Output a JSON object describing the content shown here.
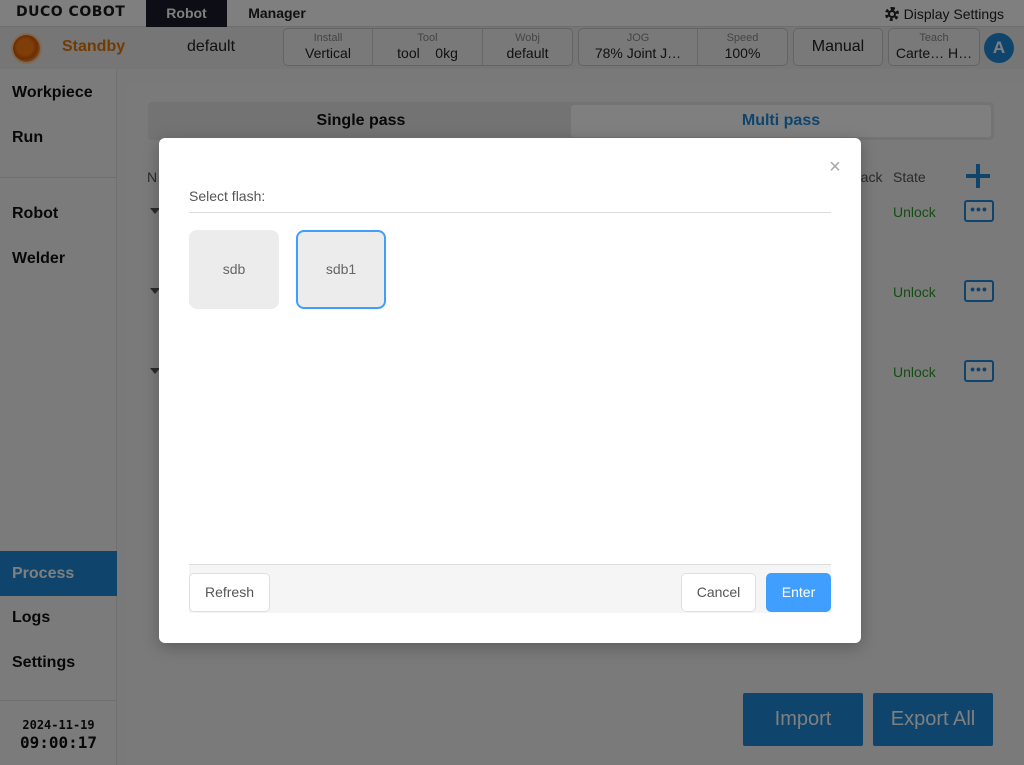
{
  "topbar": {
    "logo": "DUCO COBOT",
    "tabs": [
      {
        "label": "Robot",
        "active": true
      },
      {
        "label": "Manager",
        "active": false
      }
    ],
    "display_settings": "Display Settings"
  },
  "status": {
    "state": "Standby",
    "state_color": "#e67600",
    "profile": "default",
    "install": {
      "caption": "Install",
      "value": "Vertical"
    },
    "tool": {
      "caption": "Tool",
      "name": "tool",
      "load": "0kg"
    },
    "wobj": {
      "caption": "Wobj",
      "value": "default"
    },
    "jog": {
      "caption": "JOG",
      "value": "78%  Joint J…"
    },
    "speed": {
      "caption": "Speed",
      "value": "100%"
    },
    "mode": "Manual",
    "teach": {
      "caption": "Teach",
      "value": "Carte…  H…"
    },
    "user_initial": "A"
  },
  "sidebar": {
    "items": [
      {
        "label": "Workpiece"
      },
      {
        "label": "Run"
      },
      {
        "label": "Robot"
      },
      {
        "label": "Welder"
      },
      {
        "label": "Process",
        "active": true
      },
      {
        "label": "Logs"
      },
      {
        "label": "Settings"
      }
    ],
    "date": "2024-11-19",
    "time": "09:00:17"
  },
  "main": {
    "tabs": [
      {
        "label": "Single pass"
      },
      {
        "label": "Multi pass",
        "active": true
      }
    ],
    "columns": {
      "name_partial": "N",
      "track_partial": "rack",
      "state": "State"
    },
    "rows": [
      {
        "state": "Unlock"
      },
      {
        "state": "Unlock"
      },
      {
        "state": "Unlock"
      }
    ],
    "import_label": "Import",
    "export_label": "Export All",
    "accent": "#1f8bd8"
  },
  "dialog": {
    "label": "Select flash:",
    "close_glyph": "×",
    "flash_options": [
      {
        "name": "sdb"
      },
      {
        "name": "sdb1",
        "selected": true
      }
    ],
    "refresh_label": "Refresh",
    "cancel_label": "Cancel",
    "enter_label": "Enter"
  }
}
